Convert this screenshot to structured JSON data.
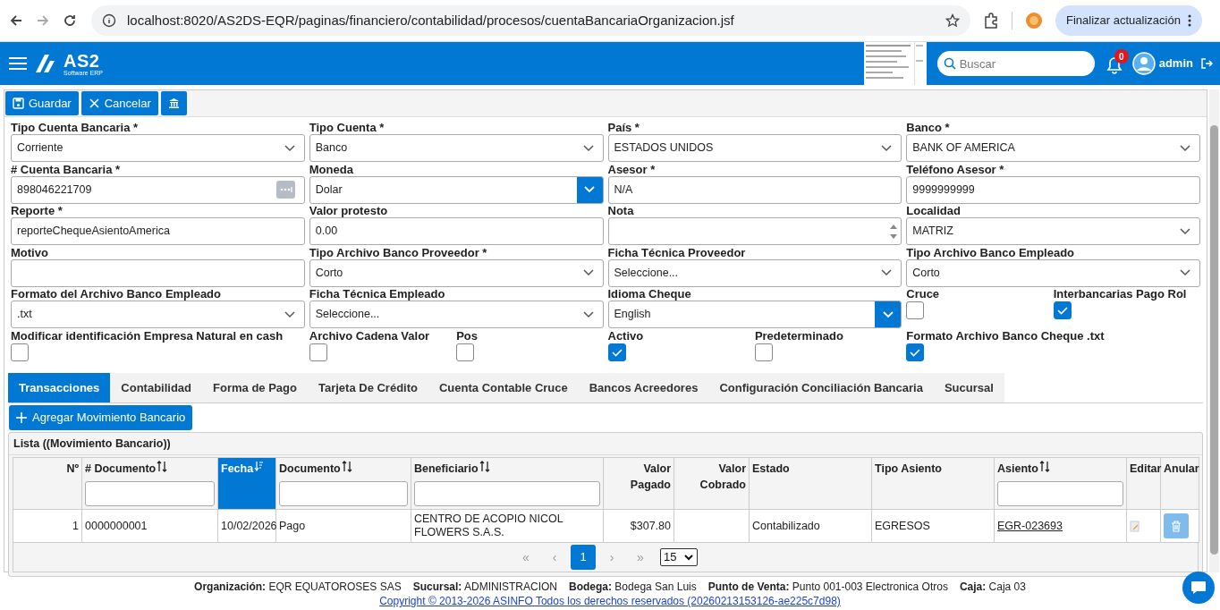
{
  "browser": {
    "url": "localhost:8020/AS2DS-EQR/paginas/financiero/contabilidad/procesos/cuentaBancariaOrganizacion.jsf",
    "update_button": "Finalizar actualización"
  },
  "header": {
    "logo": "AS2",
    "logo_sub": "Software ERP",
    "search": {
      "placeholder": "Buscar"
    },
    "notifications": "0",
    "user": "admin"
  },
  "toolbar": [
    {
      "kind": "save",
      "label": "Guardar"
    },
    {
      "kind": "cancel",
      "label": "Cancelar"
    },
    {
      "kind": "bank"
    }
  ],
  "form": {
    "rows": [
      {
        "columns": [
          {
            "fields": [
              {
                "kind": "select",
                "label": "Tipo Cuenta Bancaria *",
                "value": "Corriente"
              }
            ]
          },
          {
            "fields": [
              {
                "kind": "select",
                "label": "Tipo Cuenta *",
                "value": "Banco"
              }
            ]
          },
          {
            "fields": [
              {
                "kind": "select",
                "label": "País *",
                "value": "ESTADOS UNIDOS"
              }
            ]
          },
          {
            "fields": [
              {
                "kind": "select",
                "label": "Banco *",
                "value": "BANK OF AMERICA"
              }
            ]
          }
        ]
      },
      {
        "columns": [
          {
            "fields": [
              {
                "kind": "lookup",
                "label": "# Cuenta Bancaria *",
                "value": "898046221709"
              }
            ]
          },
          {
            "fields": [
              {
                "kind": "combo",
                "label": "Moneda",
                "value": "Dolar"
              }
            ]
          },
          {
            "fields": [
              {
                "kind": "input",
                "label": "Asesor *",
                "value": "N/A"
              }
            ]
          },
          {
            "fields": [
              {
                "kind": "input",
                "label": "Teléfono Asesor *",
                "value": "9999999999"
              }
            ]
          }
        ]
      },
      {
        "columns": [
          {
            "fields": [
              {
                "kind": "input",
                "label": "Reporte *",
                "value": "reporteChequeAsientoAmerica"
              }
            ]
          },
          {
            "fields": [
              {
                "kind": "input",
                "label": "Valor protesto",
                "value": "0.00"
              }
            ]
          },
          {
            "fields": [
              {
                "kind": "textarea",
                "label": "Nota"
              }
            ]
          },
          {
            "fields": [
              {
                "kind": "select",
                "label": "Localidad",
                "value": "MATRIZ"
              }
            ]
          }
        ]
      },
      {
        "columns": [
          {
            "fields": [
              {
                "kind": "input",
                "label": "Motivo"
              }
            ]
          },
          {
            "fields": [
              {
                "kind": "select",
                "label": "Tipo Archivo Banco Proveedor *",
                "value": "Corto"
              }
            ]
          },
          {
            "fields": [
              {
                "kind": "select",
                "label": "Ficha Técnica Proveedor",
                "value": "Seleccione..."
              }
            ]
          },
          {
            "fields": [
              {
                "kind": "select",
                "label": "Tipo Archivo Banco Empleado",
                "value": "Corto"
              }
            ]
          }
        ]
      },
      {
        "columns": [
          {
            "fields": [
              {
                "kind": "select",
                "label": "Formato del Archivo Banco Empleado",
                "value": ".txt"
              }
            ]
          },
          {
            "fields": [
              {
                "kind": "select",
                "label": "Ficha Técnica Empleado",
                "value": "Seleccione..."
              }
            ]
          },
          {
            "fields": [
              {
                "kind": "combo",
                "label": "Idioma Cheque",
                "value": "English"
              }
            ]
          },
          {
            "fields": [
              {
                "kind": "checkbox",
                "label": "Cruce",
                "checked": false
              },
              {
                "kind": "checkbox",
                "label": "Interbancarias Pago Rol",
                "checked": true
              }
            ]
          }
        ]
      },
      {
        "columns": [
          {
            "fields": [
              {
                "kind": "checkbox",
                "label": "Modificar identificación Empresa Natural en cash",
                "checked": false
              }
            ]
          },
          {
            "fields": [
              {
                "kind": "checkbox",
                "label": "Archivo Cadena Valor",
                "checked": false
              },
              {
                "kind": "checkbox",
                "label": "Pos",
                "checked": false
              }
            ]
          },
          {
            "fields": [
              {
                "kind": "checkbox",
                "label": "Activo",
                "checked": true
              },
              {
                "kind": "checkbox",
                "label": "Predeterminado",
                "checked": false
              }
            ]
          },
          {
            "fields": [
              {
                "kind": "checkbox",
                "label": "Formato Archivo Banco Cheque .txt",
                "checked": true
              }
            ]
          }
        ]
      }
    ]
  },
  "tabs": [
    {
      "label": "Transacciones",
      "selected": true
    },
    {
      "label": "Contabilidad",
      "selected": false
    },
    {
      "label": "Forma de Pago",
      "selected": false
    },
    {
      "label": "Tarjeta De Crédito",
      "selected": false
    },
    {
      "label": "Cuenta Contable Cruce",
      "selected": false
    },
    {
      "label": "Bancos Acreedores",
      "selected": false
    },
    {
      "label": "Configuración Conciliación Bancaria",
      "selected": false
    },
    {
      "label": "Sucursal",
      "selected": false
    }
  ],
  "add_button": "Agregar Movimiento Bancario",
  "table": {
    "title": "Lista ((Movimiento Bancario))",
    "columns": [
      {
        "label": "Nº"
      },
      {
        "label": "# Documento",
        "sortable": true,
        "filter": true
      },
      {
        "label": "Fecha",
        "sortable": true,
        "sorted": true
      },
      {
        "label": "Documento",
        "sortable": true,
        "filter": true
      },
      {
        "label": "Beneficiario",
        "sortable": true,
        "filter": true
      },
      {
        "label": "Valor Pagado"
      },
      {
        "label": "Valor Cobrado"
      },
      {
        "label": "Estado"
      },
      {
        "label": "Tipo Asiento"
      },
      {
        "label": "Asiento",
        "sortable": true,
        "filter": true
      },
      {
        "label": "Editar"
      },
      {
        "label": "Anular"
      }
    ],
    "rows": [
      {
        "cells": [
          {
            "kind": "text",
            "text": "1"
          },
          {
            "kind": "text",
            "text": "0000000001"
          },
          {
            "kind": "text",
            "text": "10/02/2026"
          },
          {
            "kind": "text",
            "text": "Pago"
          },
          {
            "kind": "text",
            "text": "CENTRO DE ACOPIO NICOL FLOWERS S.A.S."
          },
          {
            "kind": "text",
            "text": "$307.80"
          },
          {
            "kind": "text"
          },
          {
            "kind": "text",
            "text": "Contabilizado"
          },
          {
            "kind": "text",
            "text": "EGRESOS"
          },
          {
            "kind": "link",
            "text": "EGR-023693"
          },
          {
            "kind": "edit"
          },
          {
            "kind": "delete"
          }
        ]
      }
    ],
    "pagination": {
      "first": "«",
      "prev": "‹",
      "pages": [
        {
          "label": "1",
          "selected": true
        }
      ],
      "next": "›",
      "last": "»",
      "page_size": "15"
    }
  },
  "footer": {
    "items": [
      {
        "label": "Organización:",
        "value": "EQR EQUATOROSES SAS"
      },
      {
        "label": "Sucursal:",
        "value": "ADMINISTRACION"
      },
      {
        "label": "Bodega:",
        "value": "Bodega San Luis"
      },
      {
        "label": "Punto de Venta:",
        "value": "Punto 001-003 Electronica Otros"
      },
      {
        "label": "Caja:",
        "value": "Caja 03"
      }
    ],
    "copyright": "Copyright © 2013-2026 ASINFO Todos los derechos reservados (20260213153126-ae225c7d98)"
  }
}
